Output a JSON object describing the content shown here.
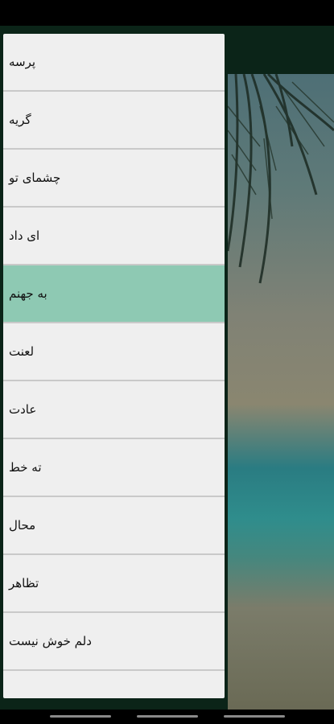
{
  "drawer": {
    "items": [
      {
        "label": "پرسه",
        "active": false
      },
      {
        "label": "گریه",
        "active": false
      },
      {
        "label": "چشمای تو",
        "active": false
      },
      {
        "label": "ای داد",
        "active": false
      },
      {
        "label": "به جهنم",
        "active": true
      },
      {
        "label": "لعنت",
        "active": false
      },
      {
        "label": "عادت",
        "active": false
      },
      {
        "label": "ته خط",
        "active": false
      },
      {
        "label": "محال",
        "active": false
      },
      {
        "label": "تظاهر",
        "active": false
      },
      {
        "label": "دلم خوش نیست",
        "active": false
      }
    ]
  },
  "player": {
    "controls": [
      {
        "name": "previous-icon",
        "glyph": "◀"
      },
      {
        "name": "repeat-icon",
        "glyph": "↻"
      },
      {
        "name": "next-icon",
        "glyph": "▶"
      }
    ]
  },
  "colors": {
    "accent": "#8ec9b3",
    "drawer_bg": "#0b2418",
    "list_bg": "#efefef"
  }
}
